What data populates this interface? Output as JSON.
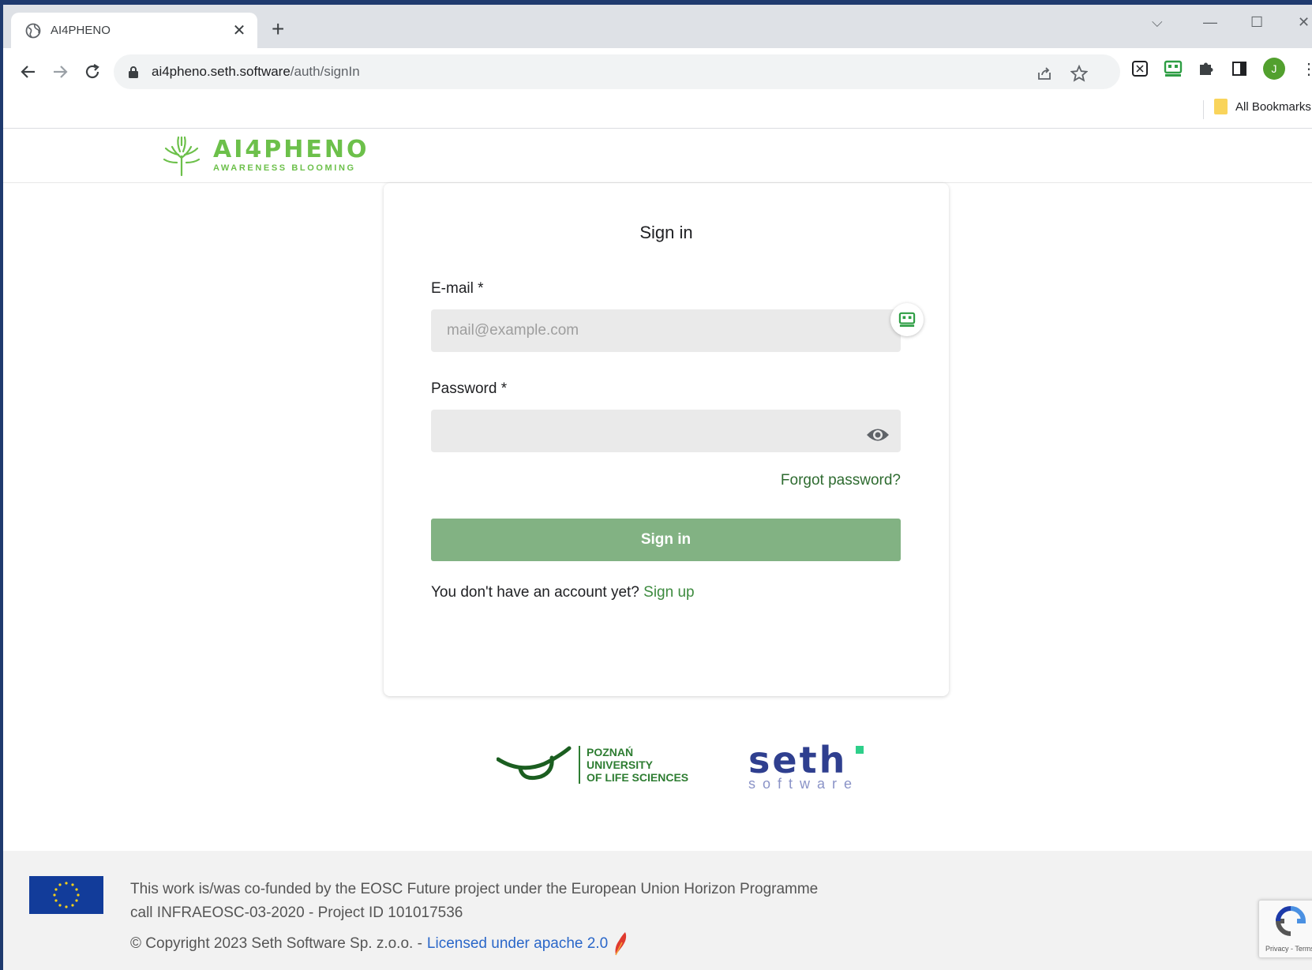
{
  "browser": {
    "tab_title": "AI4PHENO",
    "url_domain": "ai4pheno.seth.software",
    "url_path": "/auth/signIn",
    "profile_initial": "J",
    "bookmarks_label": "All Bookmarks"
  },
  "site": {
    "logo_word": "AI4PHENO",
    "logo_tagline": "AWARENESS BLOOMING",
    "brand_color": "#6cc04a"
  },
  "form": {
    "title": "Sign in",
    "email_label": "E-mail *",
    "email_placeholder": "mail@example.com",
    "email_value": "",
    "password_label": "Password *",
    "password_value": "",
    "forgot_link": "Forgot password?",
    "submit_label": "Sign in",
    "signup_prompt": "You don't have an account yet?",
    "signup_link": "Sign up",
    "button_color": "#82b283"
  },
  "partners": {
    "pul_lines": [
      "POZNAŃ",
      "UNIVERSITY",
      "OF LIFE SCIENCES"
    ],
    "seth_word": "seth",
    "seth_sub": "software"
  },
  "footer": {
    "funding_line1": "This work is/was co-funded by the EOSC Future project under the European Union Horizon Programme",
    "funding_line2": "call INFRAEOSC-03-2020 - Project ID 101017536",
    "copyright": "© Copyright 2023 Seth Software Sp. z.o.o. -",
    "license_link": "Licensed under apache 2.0",
    "recaptcha_text": "Privacy - Terms"
  }
}
